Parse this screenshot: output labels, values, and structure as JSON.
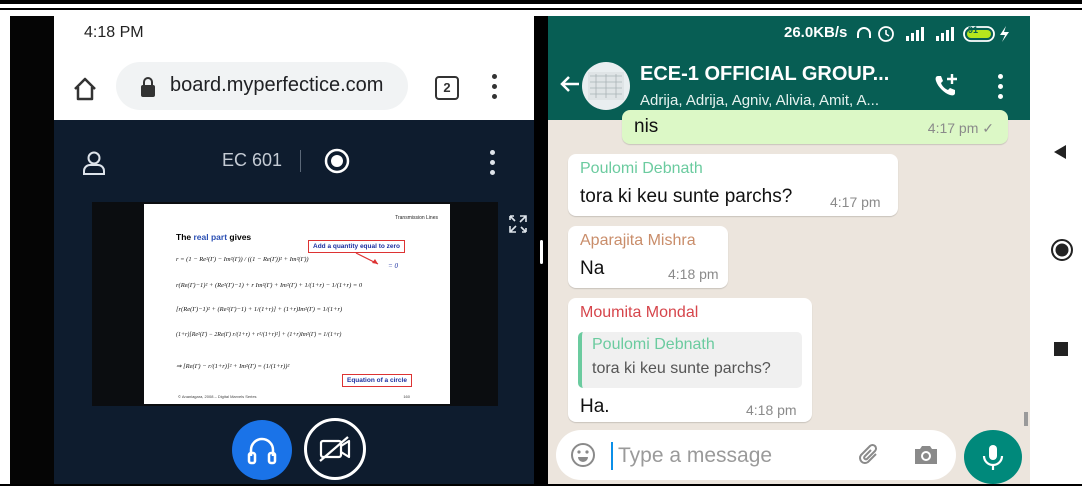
{
  "browser": {
    "status_time": "4:18 PM",
    "url": "board.myperfectice.com",
    "tab_count": "2"
  },
  "meeting": {
    "title": "EC 601",
    "slide": {
      "header": "Transmission Lines",
      "title_prefix": "The",
      "title_highlight": "real part",
      "title_suffix": "gives",
      "callout_top": "Add a quantity equal to zero",
      "callout_bottom": "Equation of a circle",
      "footer": "© Ananiagara, 2008 – Digital Marvels Series",
      "page_number": "160",
      "equations": [
        "r = (1 − Re²(Γ) − Im²(Γ)) / ((1 − Re(Γ))² + Im²(Γ))",
        "r(Re(Γ)−1)² + (Re²(Γ)−1) + r Im²(Γ) + Im²(Γ) + 1/(1+r) − 1/(1+r) = 0",
        "[r(Re(Γ)−1)² + (Re²(Γ)−1) + 1/(1+r)] + (1+r)Im²(Γ) = 1/(1+r)",
        "(1+r)[Re²(Γ) − 2Re(Γ) r/(1+r) + r²/(1+r)²] + (1+r)Im²(Γ) = 1/(1+r)",
        "⇒ [Re(Γ) − r/(1+r)]² + Im²(Γ) = (1/(1+r))²"
      ],
      "zero_label": "= 0"
    }
  },
  "whatsapp": {
    "net_speed": "26.0KB/s",
    "battery": "91",
    "group_name": "ECE-1 OFFICIAL GROUP...",
    "members": "Adrija, Adrija, Agniv, Alivia, Amit, A...",
    "messages": [
      {
        "direction": "out",
        "text": "nis",
        "time": "4:17 pm ✓"
      },
      {
        "sender": "Poulomi Debnath",
        "sender_color": "#6bcb9f",
        "text": "tora ki keu sunte parchs?",
        "time": "4:17 pm"
      },
      {
        "sender": "Aparajita Mishra",
        "sender_color": "#c98d6a",
        "text": "Na",
        "time": "4:18 pm"
      },
      {
        "sender": "Moumita Mondal",
        "sender_color": "#d6454b",
        "quote_sender": "Poulomi Debnath",
        "quote_text": "tora ki keu sunte parchs?",
        "text": "Ha.",
        "time": "4:18 pm"
      }
    ],
    "input_placeholder": "Type a message"
  },
  "colors": {
    "wa_green": "#075e54",
    "wa_fab": "#00897b",
    "meet_dark": "#0e1c2e",
    "meet_blue": "#1a73e8"
  }
}
